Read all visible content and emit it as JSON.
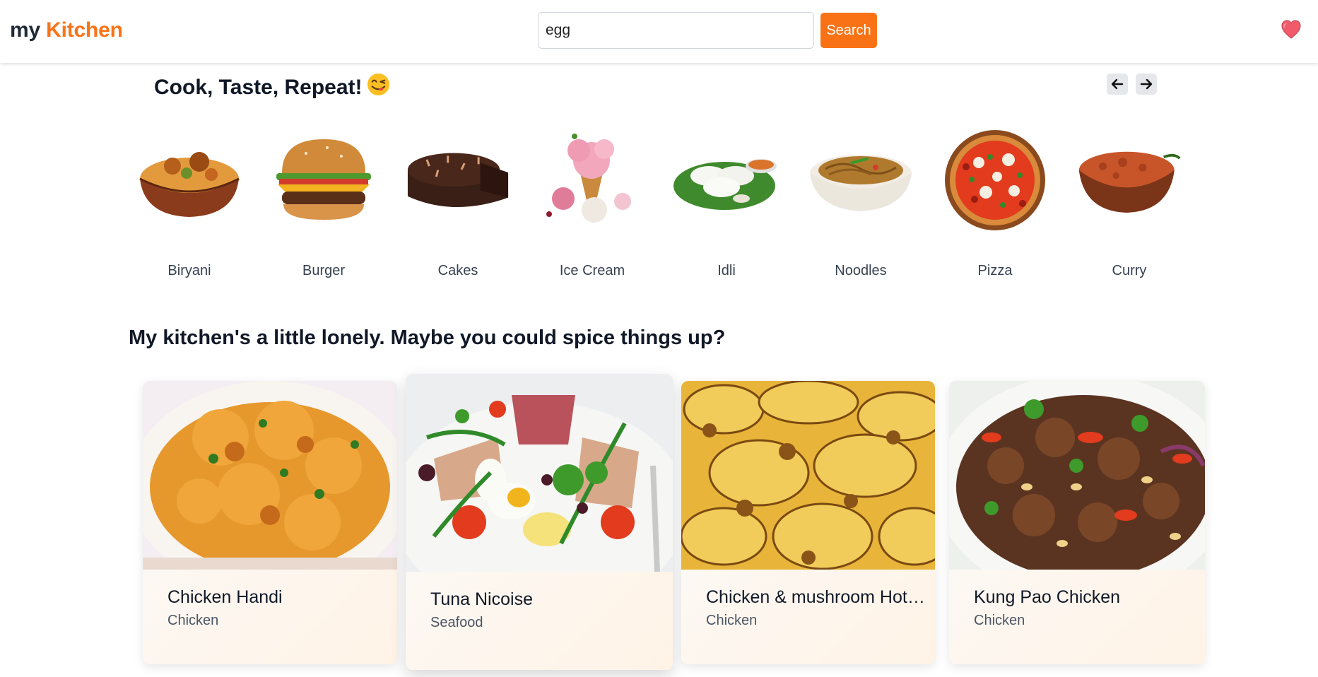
{
  "header": {
    "logo_part1": "my",
    "logo_part2": "Kitchen",
    "search_value": "egg",
    "search_button": "Search",
    "accent": "#f97316",
    "favorites_icon": "heart-icon"
  },
  "categories_section": {
    "title": "Cook, Taste, Repeat!",
    "emoji": "😋",
    "items": [
      {
        "label": "Biryani"
      },
      {
        "label": "Burger"
      },
      {
        "label": "Cakes"
      },
      {
        "label": "Ice Cream"
      },
      {
        "label": "Idli"
      },
      {
        "label": "Noodles"
      },
      {
        "label": "Pizza"
      },
      {
        "label": "Curry"
      }
    ]
  },
  "recipes_section": {
    "title": "My kitchen's a little lonely. Maybe you could spice things up?",
    "cards": [
      {
        "name": "Chicken Handi",
        "category": "Chicken"
      },
      {
        "name": "Tuna Nicoise",
        "category": "Seafood"
      },
      {
        "name": "Chicken & mushroom Hotpot",
        "category": "Chicken"
      },
      {
        "name": "Kung Pao Chicken",
        "category": "Chicken"
      }
    ]
  }
}
